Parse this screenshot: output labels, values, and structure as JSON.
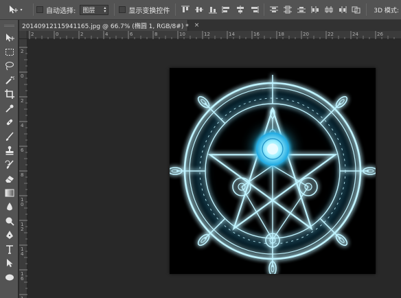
{
  "options_bar": {
    "tool_preset_icon": "move-tool-icon",
    "auto_select_label": "自动选择:",
    "auto_select_value": "图层",
    "show_transform_label": "显示变换控件",
    "mode_3d_label": "3D 模式:"
  },
  "toolbox": {
    "tools": [
      {
        "name": "move-tool-icon"
      },
      {
        "name": "rectangular-marquee-icon"
      },
      {
        "name": "lasso-icon"
      },
      {
        "name": "magic-wand-icon"
      },
      {
        "name": "crop-icon"
      },
      {
        "name": "eyedropper-icon"
      },
      {
        "name": "healing-brush-icon"
      },
      {
        "name": "brush-icon"
      },
      {
        "name": "clone-stamp-icon"
      },
      {
        "name": "history-brush-icon"
      },
      {
        "name": "eraser-icon"
      },
      {
        "name": "gradient-icon"
      },
      {
        "name": "blur-icon"
      },
      {
        "name": "dodge-icon"
      },
      {
        "name": "pen-icon"
      },
      {
        "name": "type-icon"
      },
      {
        "name": "path-selection-icon"
      },
      {
        "name": "ellipse-shape-icon"
      }
    ]
  },
  "document_tab": {
    "title": "20140912115941165.jpg @ 66.7% (椭圆 1, RGB/8#) *",
    "close": "×"
  },
  "rulers": {
    "top_labels": [
      "2",
      "0",
      "2",
      "4",
      "6",
      "8",
      "10",
      "12",
      "14",
      "16",
      "18",
      "20",
      "22",
      "24",
      "26"
    ],
    "left_labels": [
      "2",
      "0",
      "2",
      "4",
      "6",
      "8",
      "1\n0",
      "1\n2",
      "1\n4",
      "1\n6",
      "1\n8",
      "2\n0"
    ]
  },
  "colors": {
    "panel": "#535353",
    "workspace": "#282828",
    "glow": "#39d2ff"
  }
}
